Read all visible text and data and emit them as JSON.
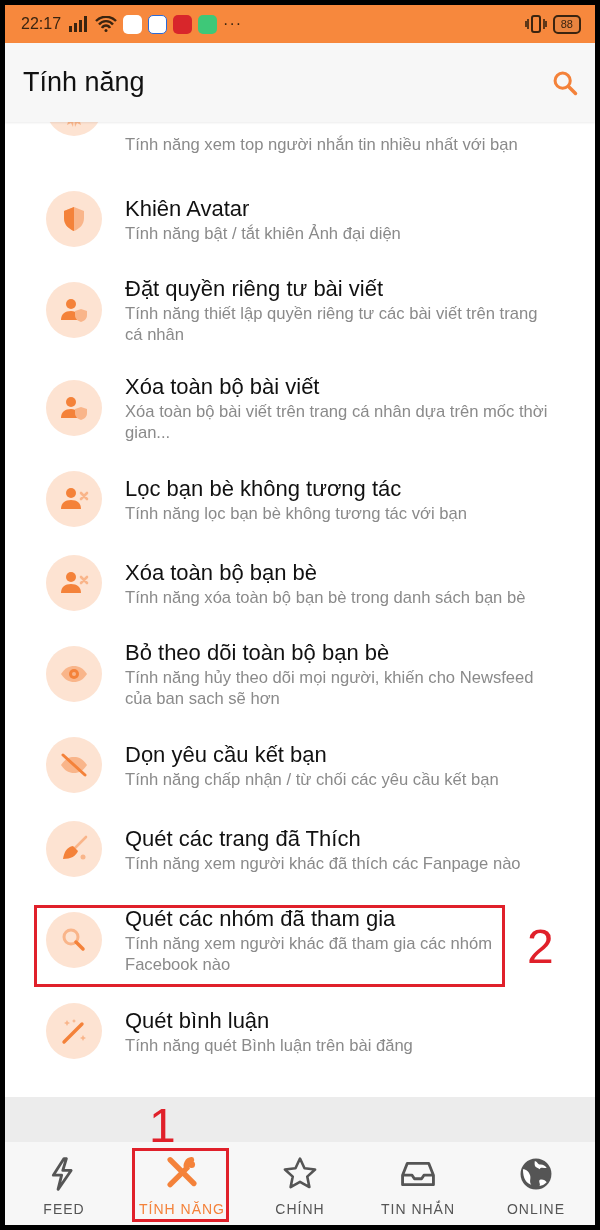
{
  "status_bar": {
    "time": "22:17",
    "more": "···",
    "battery": "88"
  },
  "header": {
    "title": "Tính năng"
  },
  "features": [
    {
      "kind": "ribbon",
      "subtitle": "Tính năng xem top người nhắn tin nhiều nhất với bạn"
    },
    {
      "kind": "shield",
      "title": "Khiên Avatar",
      "subtitle": "Tính năng bật / tắt khiên Ảnh đại diện"
    },
    {
      "kind": "privacy",
      "title": "Đặt quyền riêng tư bài viết",
      "subtitle": "Tính năng thiết lập quyền riêng tư các bài viết trên trang cá nhân"
    },
    {
      "kind": "privacy",
      "title": "Xóa toàn bộ bài viết",
      "subtitle": "Xóa toàn bộ bài viết trên trang cá nhân dựa trên mốc thời gian..."
    },
    {
      "kind": "unfriend",
      "title": "Lọc bạn bè không tương tác",
      "subtitle": "Tính năng lọc bạn bè không tương tác với bạn"
    },
    {
      "kind": "unfriend",
      "title": "Xóa toàn bộ bạn bè",
      "subtitle": "Tính năng xóa toàn bộ bạn bè trong danh sách bạn bè"
    },
    {
      "kind": "eye",
      "title": "Bỏ theo dõi toàn bộ bạn bè",
      "subtitle": "Tính năng hủy theo dõi mọi người, khiến cho Newsfeed của ban sach sẽ hơn"
    },
    {
      "kind": "hidden",
      "title": "Dọn yêu cầu kết bạn",
      "subtitle": "Tính năng chấp nhận / từ chối các yêu cầu kết bạn"
    },
    {
      "kind": "broom",
      "title": "Quét các trang đã Thích",
      "subtitle": "Tính năng xem người khác đã thích các Fanpage nào"
    },
    {
      "kind": "search",
      "title": "Quét các nhóm đã tham gia",
      "subtitle": "Tính năng xem người khác đã tham gia các nhóm Facebook nào",
      "marker": "2"
    },
    {
      "kind": "wand",
      "title": "Quét bình luận",
      "subtitle": "Tính năng quét Bình luận trên bài đăng"
    }
  ],
  "bottom_nav": [
    {
      "kind": "bolt",
      "label": "FEED",
      "selected": false
    },
    {
      "kind": "tools",
      "label": "TÍNH NĂNG",
      "selected": true,
      "marker": "1"
    },
    {
      "kind": "star",
      "label": "CHÍNH",
      "selected": false
    },
    {
      "kind": "inbox",
      "label": "TIN NHẮN",
      "selected": false
    },
    {
      "kind": "globe",
      "label": "ONLINE",
      "selected": false
    }
  ]
}
